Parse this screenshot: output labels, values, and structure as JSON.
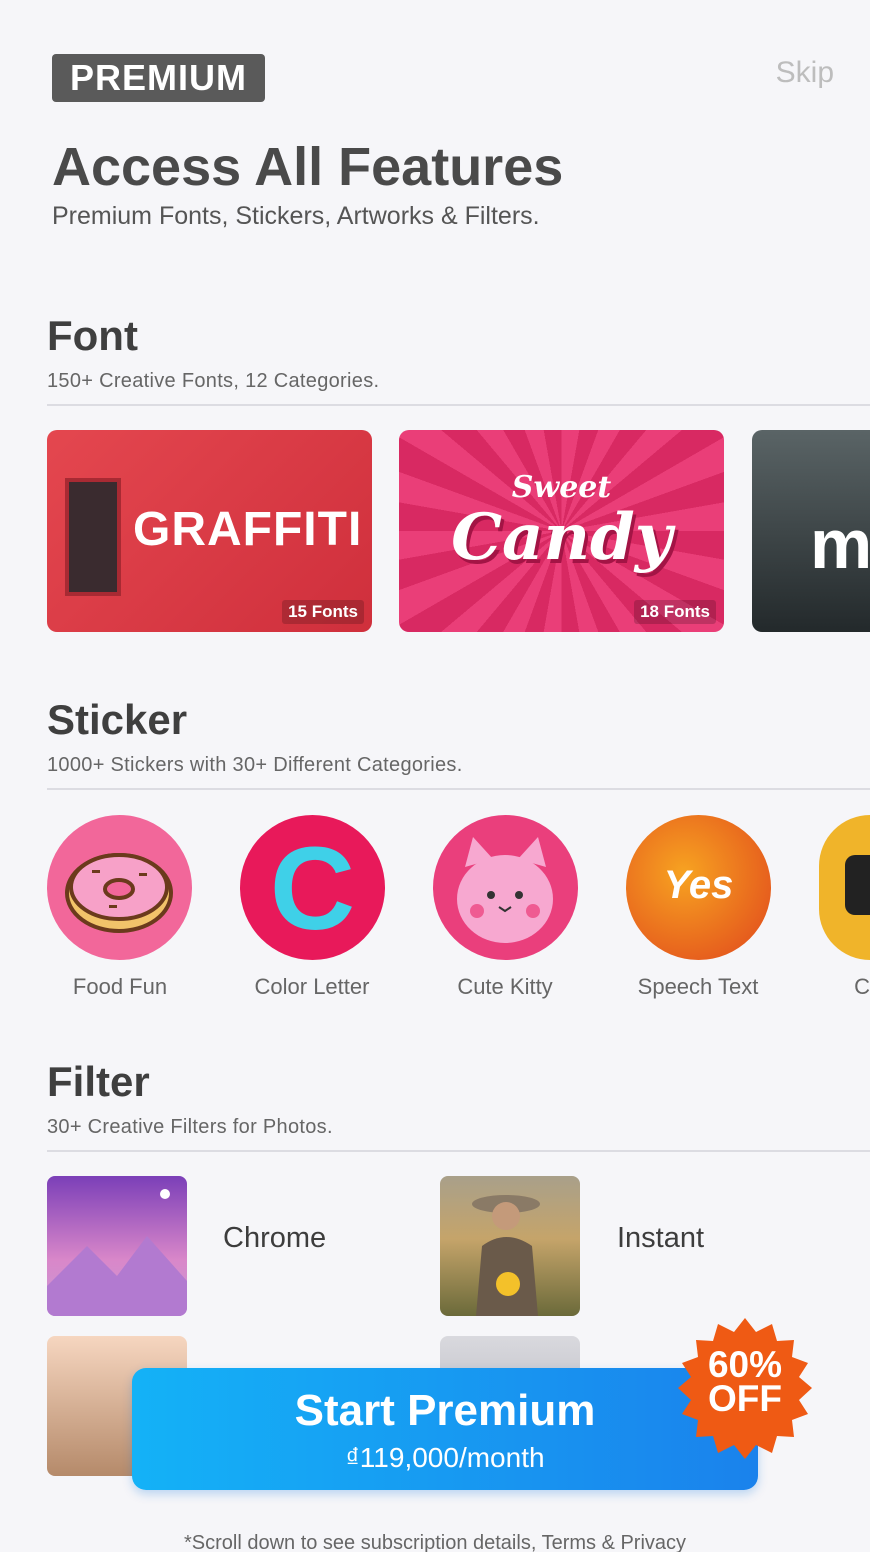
{
  "header": {
    "badge": "PREMIUM",
    "skip": "Skip"
  },
  "hero": {
    "title": "Access All Features",
    "subtitle": "Premium Fonts, Stickers, Artworks & Filters."
  },
  "font_section": {
    "title": "Font",
    "subtitle": "150+ Creative Fonts, 12 Categories.",
    "cards": [
      {
        "art": "GRAFFITI",
        "count": "15 Fonts"
      },
      {
        "art_top": "Sweet",
        "art_main": "Candy",
        "count": "18 Fonts"
      },
      {
        "art": "m"
      }
    ]
  },
  "sticker_section": {
    "title": "Sticker",
    "subtitle": "1000+ Stickers with 30+ Different Categories.",
    "items": [
      {
        "label": "Food Fun"
      },
      {
        "label": "Color Letter",
        "glyph": "C"
      },
      {
        "label": "Cute Kitty"
      },
      {
        "label": "Speech Text",
        "glyph": "Yes"
      },
      {
        "label": "C"
      }
    ]
  },
  "filter_section": {
    "title": "Filter",
    "subtitle": "30+ Creative Filters for Photos.",
    "items": [
      {
        "label": "Chrome"
      },
      {
        "label": "Instant"
      }
    ]
  },
  "cta": {
    "title": "Start Premium",
    "price": "₫119,000/month",
    "offer_line1": "60%",
    "offer_line2": "OFF"
  },
  "footer_note": "*Scroll down to see subscription details, Terms & Privacy",
  "colors": {
    "cta": "#1a9cf2",
    "offer": "#f05a12",
    "graffiti_bg": "#e0414b",
    "candy_bg": "#e8316d",
    "kitty_bg": "#ea3f7c"
  }
}
